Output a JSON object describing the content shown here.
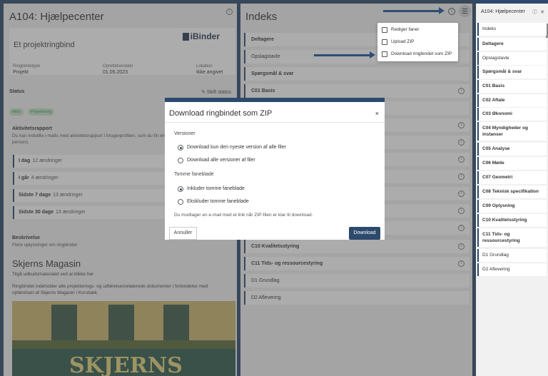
{
  "left": {
    "title": "A104: Hjælpecenter",
    "subtitle": "Et projektringbind",
    "logo": "iBinder",
    "meta": [
      {
        "label": "Ringbindstype",
        "value": "Projekt"
      },
      {
        "label": "Oprettelsesdato",
        "value": "01.05.2023"
      },
      {
        "label": "Lokation",
        "value": "Ikke angivet"
      }
    ],
    "status_label": "Status",
    "status_button": "Skift status",
    "chips": [
      "Aktiv",
      "Projektering"
    ],
    "activity_heading": "Aktivitetsrapport",
    "activity_text": "Du kan indstille i-mails med aktivitetsrapport i brugerprofilen, som du fin en person).",
    "activity_rows": [
      {
        "label": "I dag",
        "count": "12 ændringer"
      },
      {
        "label": "I går",
        "count": "4 ændringer"
      },
      {
        "label": "Sidste 7 dage",
        "count": "13 ændringer"
      },
      {
        "label": "Sidste 30 dage",
        "count": "13 ændringer"
      }
    ],
    "desc_heading": "Beskrivelse",
    "desc_text": "Flere oplysninger om ringbindet",
    "magasin_title": "Skjerns Magasin",
    "magasin_line1": "Tilgå udbudsmaterialet ved at klikke her",
    "magasin_line2": "Ringbindet indeholder alle projekterings- og udførelsesrelaterede dokumenter i forbindelse med opførelsen af Skjerns Magasin i Korsbæk.",
    "photo_sign": "SKJERNS"
  },
  "middle": {
    "title": "Indeks",
    "rows": [
      {
        "label": "Deltagere",
        "bold": true
      },
      {
        "label": "Opslagstavle",
        "bold": false
      },
      {
        "label": "Spørgsmål & svar",
        "bold": true
      },
      {
        "label": "C01 Basis",
        "bold": true
      },
      {
        "label": "C10 Kvalitetsstyring",
        "bold": true
      },
      {
        "label": "C11 Tids- og ressourcestyring",
        "bold": true
      },
      {
        "label": "D1 Grundlag",
        "bold": false
      },
      {
        "label": "D2 Aflevering",
        "bold": false
      }
    ]
  },
  "menu": {
    "items": [
      "Rediger faner",
      "Upload ZIP",
      "Download ringbindet som ZIP"
    ]
  },
  "right": {
    "title": "A104: Hjælpecenter",
    "rows": [
      {
        "label": "Indeks",
        "bold": false
      },
      {
        "label": "Deltagere",
        "bold": true
      },
      {
        "label": "Opslagstavle",
        "bold": false
      },
      {
        "label": "Spørgsmål & svar",
        "bold": true
      },
      {
        "label": "C01 Basis",
        "bold": true
      },
      {
        "label": "C02 Aftale",
        "bold": true
      },
      {
        "label": "C03 Økonomi",
        "bold": true
      },
      {
        "label": "C04 Myndigheder og instanser",
        "bold": true
      },
      {
        "label": "C05 Analyse",
        "bold": true
      },
      {
        "label": "C06 Møde",
        "bold": true
      },
      {
        "label": "C07 Geometri",
        "bold": true
      },
      {
        "label": "C08 Teknisk specifikation",
        "bold": true
      },
      {
        "label": "C09 Oplysning",
        "bold": true
      },
      {
        "label": "C10 Kvalitetsstyring",
        "bold": true
      },
      {
        "label": "C11 Tids- og ressourcestyring",
        "bold": true
      },
      {
        "label": "D1 Grundlag",
        "bold": false
      },
      {
        "label": "D2 Aflevering",
        "bold": false
      }
    ]
  },
  "modal": {
    "title": "Download ringbindet som ZIP",
    "close": "×",
    "versions_label": "Versioner",
    "version_options": [
      {
        "label": "Download kun den nyeste version af alle filer",
        "selected": true
      },
      {
        "label": "Download alle versioner af filer",
        "selected": false
      }
    ],
    "empty_label": "Tomme faneblade",
    "empty_options": [
      {
        "label": "Inkluder tomme faneblade",
        "selected": true
      },
      {
        "label": "Ekskluder tomme faneblade",
        "selected": false
      }
    ],
    "note": "Du modtager en e-mail med et link når ZIP-filen er klar til download.",
    "cancel": "Annuller",
    "download": "Download"
  },
  "colors": {
    "primary": "#2c4a6b",
    "arrow": "#2e4e74"
  }
}
